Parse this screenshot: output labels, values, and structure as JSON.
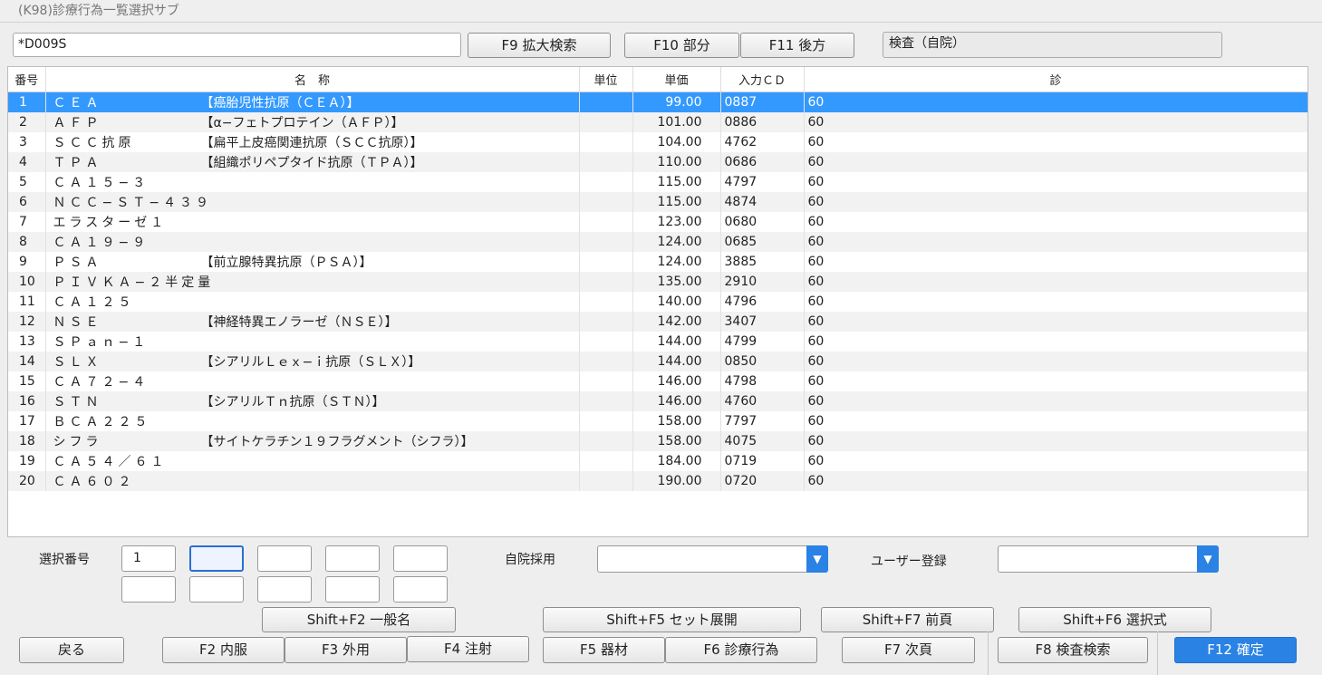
{
  "window": {
    "title": "(K98)診療行為一覧選択サブ"
  },
  "search": {
    "value": "*D009S",
    "category": "検査（自院）"
  },
  "top_buttons": {
    "f9": "F9 拡大検索",
    "f10": "F10 部分",
    "f11": "F11 後方"
  },
  "grid": {
    "headers": [
      "番号",
      "名　称",
      "単位",
      "単価",
      "入力ＣＤ",
      "診"
    ],
    "rows": [
      {
        "no": "1",
        "name": "ＣＥＡ",
        "sub": "【癌胎児性抗原（ＣＥＡ）】",
        "unit": "",
        "price": "99.00",
        "cd": "0887",
        "shin": "60"
      },
      {
        "no": "2",
        "name": "ＡＦＰ",
        "sub": "【α−フェトプロテイン（ＡＦＰ）】",
        "unit": "",
        "price": "101.00",
        "cd": "0886",
        "shin": "60"
      },
      {
        "no": "3",
        "name": "ＳＣＣ抗原",
        "sub": "【扁平上皮癌関連抗原（ＳＣＣ抗原）】",
        "unit": "",
        "price": "104.00",
        "cd": "4762",
        "shin": "60"
      },
      {
        "no": "4",
        "name": "ＴＰＡ",
        "sub": "【組織ポリペプタイド抗原（ＴＰＡ）】",
        "unit": "",
        "price": "110.00",
        "cd": "0686",
        "shin": "60"
      },
      {
        "no": "5",
        "name": "ＣＡ１５−３",
        "sub": "",
        "unit": "",
        "price": "115.00",
        "cd": "4797",
        "shin": "60"
      },
      {
        "no": "6",
        "name": "ＮＣＣ−ＳＴ−４３９",
        "sub": "",
        "unit": "",
        "price": "115.00",
        "cd": "4874",
        "shin": "60"
      },
      {
        "no": "7",
        "name": "エラスターゼ１",
        "sub": "",
        "unit": "",
        "price": "123.00",
        "cd": "0680",
        "shin": "60"
      },
      {
        "no": "8",
        "name": "ＣＡ１９−９",
        "sub": "",
        "unit": "",
        "price": "124.00",
        "cd": "0685",
        "shin": "60"
      },
      {
        "no": "9",
        "name": "ＰＳＡ",
        "sub": "【前立腺特異抗原（ＰＳＡ）】",
        "unit": "",
        "price": "124.00",
        "cd": "3885",
        "shin": "60"
      },
      {
        "no": "10",
        "name": "ＰＩＶＫＡ−２半定量",
        "sub": "",
        "unit": "",
        "price": "135.00",
        "cd": "2910",
        "shin": "60"
      },
      {
        "no": "11",
        "name": "ＣＡ１２５",
        "sub": "",
        "unit": "",
        "price": "140.00",
        "cd": "4796",
        "shin": "60"
      },
      {
        "no": "12",
        "name": "ＮＳＥ",
        "sub": "【神経特異エノラーゼ（ＮＳＥ）】",
        "unit": "",
        "price": "142.00",
        "cd": "3407",
        "shin": "60"
      },
      {
        "no": "13",
        "name": "ＳＰａｎ−１",
        "sub": "",
        "unit": "",
        "price": "144.00",
        "cd": "4799",
        "shin": "60"
      },
      {
        "no": "14",
        "name": "ＳＬＸ",
        "sub": "【シアリルＬｅｘ−ｉ抗原（ＳＬＸ）】",
        "unit": "",
        "price": "144.00",
        "cd": "0850",
        "shin": "60"
      },
      {
        "no": "15",
        "name": "ＣＡ７２−４",
        "sub": "",
        "unit": "",
        "price": "146.00",
        "cd": "4798",
        "shin": "60"
      },
      {
        "no": "16",
        "name": "ＳＴＮ",
        "sub": "【シアリルＴｎ抗原（ＳＴＮ）】",
        "unit": "",
        "price": "146.00",
        "cd": "4760",
        "shin": "60"
      },
      {
        "no": "17",
        "name": "ＢＣＡ２２５",
        "sub": "",
        "unit": "",
        "price": "158.00",
        "cd": "7797",
        "shin": "60"
      },
      {
        "no": "18",
        "name": "シフラ",
        "sub": "【サイトケラチン１９フラグメント（シフラ）】",
        "unit": "",
        "price": "158.00",
        "cd": "4075",
        "shin": "60"
      },
      {
        "no": "19",
        "name": "ＣＡ５４／６１",
        "sub": "",
        "unit": "",
        "price": "184.00",
        "cd": "0719",
        "shin": "60"
      },
      {
        "no": "20",
        "name": "ＣＡ６０２",
        "sub": "",
        "unit": "",
        "price": "190.00",
        "cd": "0720",
        "shin": "60"
      }
    ]
  },
  "selection": {
    "label": "選択番号",
    "inputs": [
      "1",
      "",
      "",
      "",
      "",
      "",
      "",
      "",
      "",
      ""
    ]
  },
  "jiin": {
    "label": "自院採用",
    "value": ""
  },
  "user_reg": {
    "label": "ユーザー登録",
    "value": ""
  },
  "buttons": {
    "shift_f2": "Shift+F2 一般名",
    "shift_f5": "Shift+F5 セット展開",
    "shift_f7": "Shift+F7 前頁",
    "shift_f6": "Shift+F6 選択式",
    "back": "戻る",
    "f2": "F2 内服",
    "f3": "F3 外用",
    "f4": "F4 注射",
    "f5": "F5 器材",
    "f6": "F6 診療行為",
    "f7": "F7 次頁",
    "f8": "F8 検査検索",
    "f12": "F12 確定"
  },
  "colors": {
    "selected_row": "#3399ff",
    "primary_button": "#2a82e4"
  }
}
